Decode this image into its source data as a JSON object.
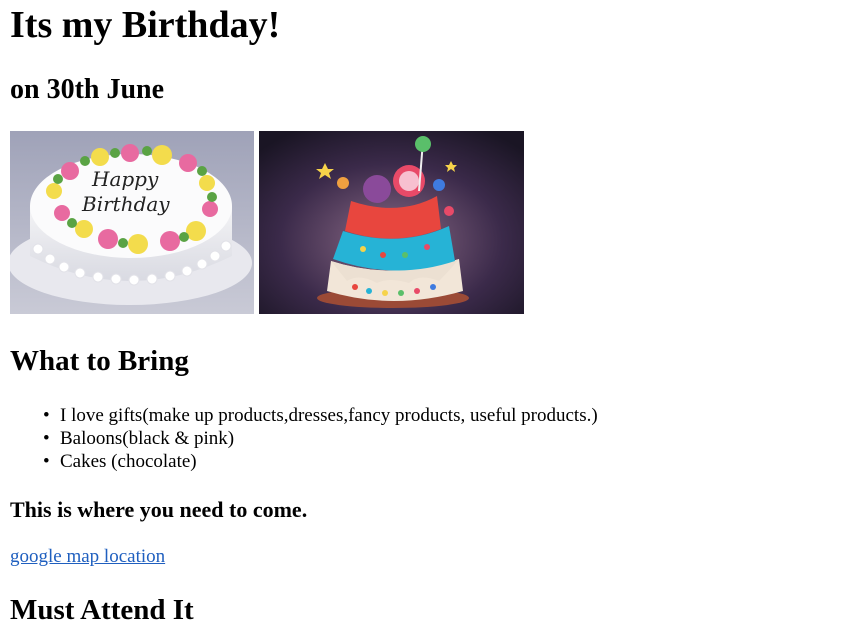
{
  "heading": "Its my Birthday!",
  "date_heading": "on 30th June",
  "images": {
    "cake1_text_line1": "Happy",
    "cake1_text_line2": "Birthday"
  },
  "bring_heading": "What to Bring",
  "bring_items": [
    "I love gifts(make up products,dresses,fancy products, useful products.)",
    "Baloons(black & pink)",
    "Cakes (chocolate)"
  ],
  "bullet_char": "•",
  "where_heading": "This is where you need to come.",
  "map_link": "google map location",
  "attend_heading": "Must Attend It",
  "colors": {
    "link": "#1f5fbf"
  }
}
